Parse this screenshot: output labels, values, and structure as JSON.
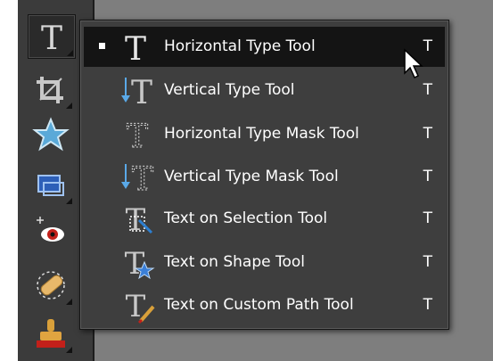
{
  "toolbar": {
    "tools": [
      {
        "icon": "type-tool-icon",
        "active": true
      },
      {
        "icon": "crop-tool-icon"
      },
      {
        "icon": "cookie-cutter-star-icon"
      },
      {
        "icon": "recompose-tool-icon"
      },
      {
        "icon": "red-eye-removal-icon"
      },
      {
        "icon": "healing-brush-bandage-icon"
      },
      {
        "icon": "clone-stamp-icon"
      }
    ]
  },
  "flyout": {
    "items": [
      {
        "label": "Horizontal Type Tool",
        "shortcut": "T",
        "icon": "horizontal-type-icon",
        "selected": true
      },
      {
        "label": "Vertical Type Tool",
        "shortcut": "T",
        "icon": "vertical-type-icon"
      },
      {
        "label": "Horizontal Type Mask Tool",
        "shortcut": "T",
        "icon": "horizontal-type-mask-icon"
      },
      {
        "label": "Vertical Type Mask Tool",
        "shortcut": "T",
        "icon": "vertical-type-mask-icon"
      },
      {
        "label": "Text on Selection Tool",
        "shortcut": "T",
        "icon": "text-on-selection-icon"
      },
      {
        "label": "Text on Shape Tool",
        "shortcut": "T",
        "icon": "text-on-shape-icon"
      },
      {
        "label": "Text on Custom Path Tool",
        "shortcut": "T",
        "icon": "text-on-custom-path-icon"
      }
    ]
  },
  "colors": {
    "panel": "#3e3e3e",
    "selected_row": "#141414",
    "canvas": "#7e7e7e",
    "text": "#ffffff"
  }
}
